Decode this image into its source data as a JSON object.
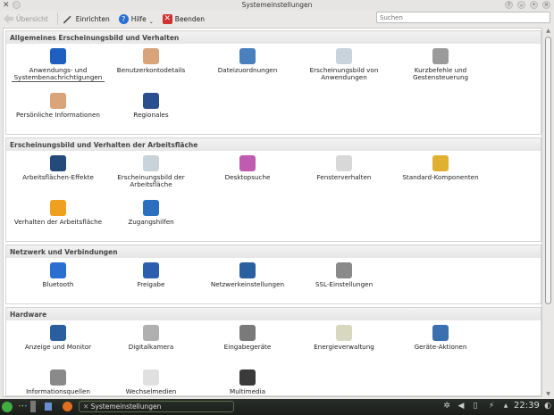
{
  "window": {
    "title": "Systemeinstellungen"
  },
  "toolbar": {
    "overview": "Übersicht",
    "configure": "Einrichten",
    "help": "Hilfe",
    "quit": "Beenden"
  },
  "search": {
    "placeholder": "Suchen"
  },
  "sections": [
    {
      "title": "Allgemeines Erscheinungsbild und Verhalten",
      "items": [
        {
          "label": "Anwendungs- und Systembenachrichtigungen",
          "color": "#1f5fbf"
        },
        {
          "label": "Benutzerkontodetails",
          "color": "#d9a47a"
        },
        {
          "label": "Dateizuordnungen",
          "color": "#4a7fc0"
        },
        {
          "label": "Erscheinungsbild von Anwendungen",
          "color": "#c9d3db"
        },
        {
          "label": "Kurzbefehle und Gestensteuerung",
          "color": "#9a9a9a"
        },
        {
          "label": "Persönliche Informationen",
          "color": "#d9a47a"
        },
        {
          "label": "Regionales",
          "color": "#2a4f8f"
        }
      ]
    },
    {
      "title": "Erscheinungsbild und Verhalten der Arbeitsfläche",
      "items": [
        {
          "label": "Arbeitsflächen-Effekte",
          "color": "#234a7a"
        },
        {
          "label": "Erscheinungsbild der Arbeitsfläche",
          "color": "#c9d3db"
        },
        {
          "label": "Desktopsuche",
          "color": "#c05cb0"
        },
        {
          "label": "Fensterverhalten",
          "color": "#d8d8d8"
        },
        {
          "label": "Standard-Komponenten",
          "color": "#e0b030"
        },
        {
          "label": "Verhalten der Arbeitsfläche",
          "color": "#f0a020"
        },
        {
          "label": "Zugangshilfen",
          "color": "#2a6fc0"
        }
      ]
    },
    {
      "title": "Netzwerk und Verbindungen",
      "items": [
        {
          "label": "Bluetooth",
          "color": "#2a6fd0"
        },
        {
          "label": "Freigabe",
          "color": "#2a5fb0"
        },
        {
          "label": "Netzwerkeinstellungen",
          "color": "#2a5fa0"
        },
        {
          "label": "SSL-Einstellungen",
          "color": "#8a8a8a"
        }
      ]
    },
    {
      "title": "Hardware",
      "items": [
        {
          "label": "Anzeige und Monitor",
          "color": "#2a5f9f"
        },
        {
          "label": "Digitalkamera",
          "color": "#b0b0b0"
        },
        {
          "label": "Eingabegeräte",
          "color": "#7a7a7a"
        },
        {
          "label": "Energieverwaltung",
          "color": "#d8d8c0"
        },
        {
          "label": "Geräte-Aktionen",
          "color": "#3a6fb0"
        },
        {
          "label": "Informationsquellen",
          "color": "#8a8a8a"
        },
        {
          "label": "Wechselmedien",
          "color": "#e0e0e0"
        },
        {
          "label": "Multimedia",
          "color": "#3a3a3a"
        }
      ]
    }
  ],
  "taskbar": {
    "task": "Systemeinstellungen",
    "clock": "22:39"
  }
}
